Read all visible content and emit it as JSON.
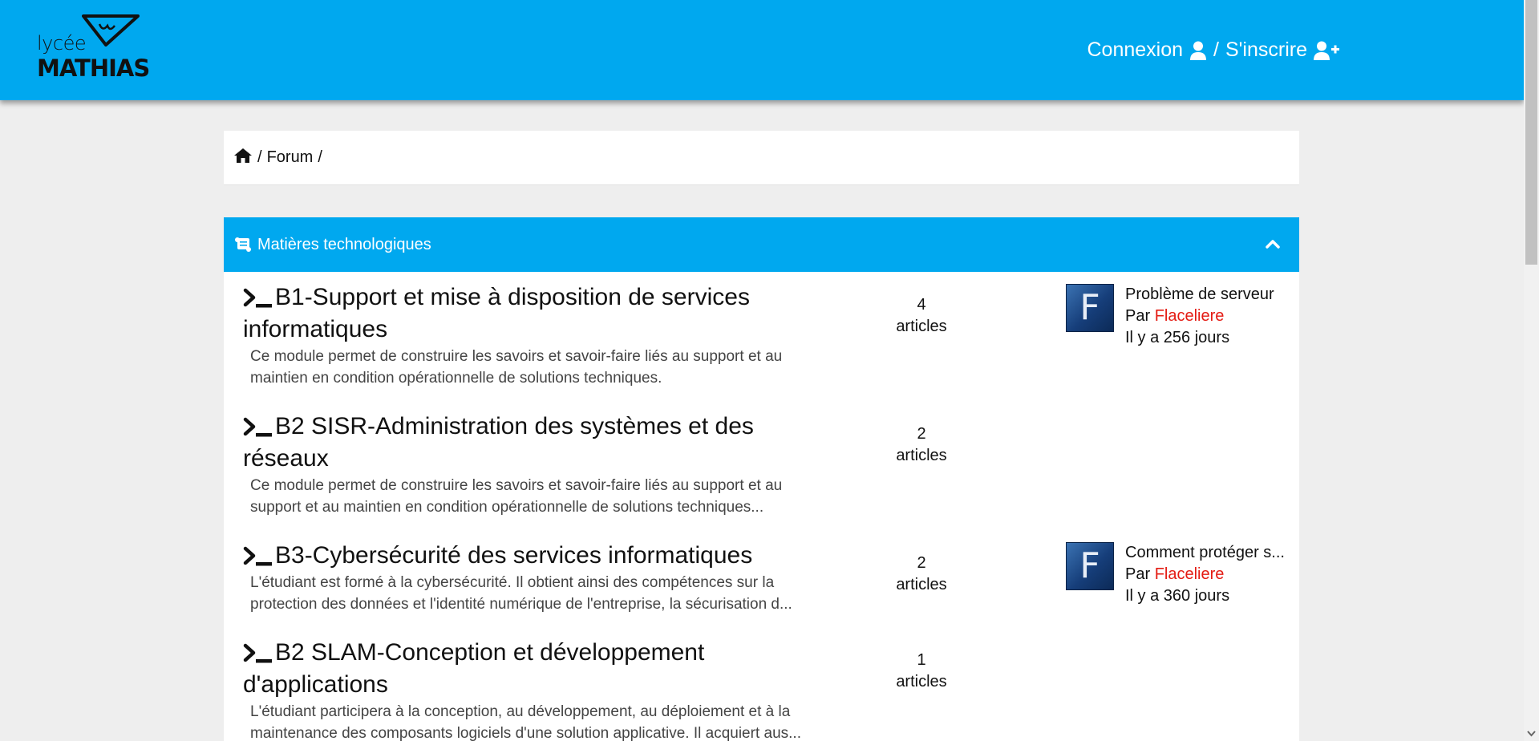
{
  "header": {
    "logo_text_top": "lycée",
    "logo_text_bottom": "MATHIAS",
    "login_label": "Connexion",
    "separator": "/",
    "register_label": "S'inscrire",
    "bg_color": "#00a8ef"
  },
  "breadcrumb": {
    "home_icon": "home-icon",
    "sep1": "/",
    "forum_label": "Forum",
    "sep2": "/"
  },
  "category": {
    "icon": "scroll-icon",
    "title": "Matières technologiques",
    "collapse_icon": "chevron-up-icon"
  },
  "forums": [
    {
      "title": "B1-Support et mise à disposition de services informatiques",
      "desc_line1": "Ce module permet de construire les savoirs et savoir-faire liés au support et au",
      "desc_line2": "maintien en condition opérationnelle de solutions techniques.",
      "count": "4",
      "count_label": "articles",
      "last_post": {
        "avatar_letter": "F",
        "title": "Problème de serveur",
        "by": "Par",
        "author": "Flaceliere",
        "ago": "Il y a 256 jours"
      }
    },
    {
      "title": "B2 SISR-Administration des systèmes et des réseaux",
      "desc_line1": "Ce module permet de construire les savoirs et savoir-faire liés au support et au",
      "desc_line2": "support et au maintien en condition opérationnelle de solutions techniques...",
      "count": "2",
      "count_label": "articles"
    },
    {
      "title": "B3-Cybersécurité des services informatiques",
      "desc_line1": "L'étudiant est formé à la cybersécurité. Il obtient ainsi des compétences sur la",
      "desc_line2": "protection des données et l'identité numérique de l'entreprise, la sécurisation d...",
      "count": "2",
      "count_label": "articles",
      "last_post": {
        "avatar_letter": "F",
        "title": "Comment protéger s...",
        "by": "Par",
        "author": "Flaceliere",
        "ago": "Il y a 360 jours"
      }
    },
    {
      "title": "B2 SLAM-Conception et développement d'applications",
      "desc_line1": "L'étudiant participera à la conception, au développement, au déploiement et à la",
      "desc_line2": "maintenance des composants logiciels d'une solution applicative. Il acquiert aus...",
      "count": "1",
      "count_label": "articles"
    }
  ]
}
